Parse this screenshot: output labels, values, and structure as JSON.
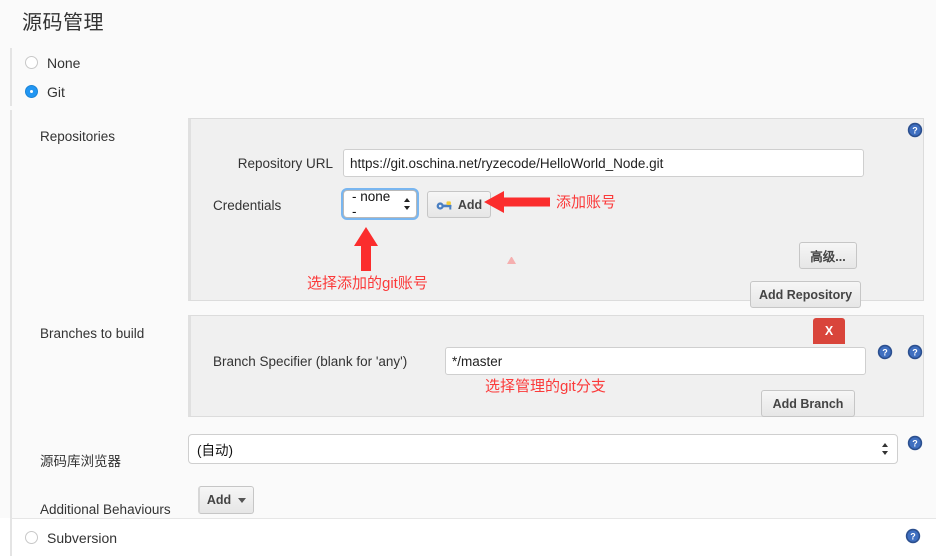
{
  "page": {
    "title": "源码管理"
  },
  "scm_options": [
    {
      "label": "None",
      "selected": false
    },
    {
      "label": "Git",
      "selected": true
    },
    {
      "label": "Subversion",
      "selected": false
    }
  ],
  "git": {
    "repositories": {
      "section_label": "Repositories",
      "repository_url": {
        "label": "Repository URL",
        "value": "https://git.oschina.net/ryzecode/HelloWorld_Node.git"
      },
      "credentials": {
        "label": "Credentials",
        "selected": "- none -",
        "options": [
          "- none -"
        ],
        "add_button": "Add",
        "add_button_icon": "key-icon"
      },
      "advanced_button": "高级...",
      "add_repository_button": "Add Repository"
    },
    "branches": {
      "section_label": "Branches to build",
      "branch_specifier": {
        "label": "Branch Specifier (blank for 'any')",
        "value": "*/master"
      },
      "delete_button": "X",
      "add_branch_button": "Add Branch"
    },
    "browser": {
      "label": "源码库浏览器",
      "selected": "(自动)",
      "options": [
        "(自动)"
      ]
    },
    "additional_behaviours": {
      "label": "Additional Behaviours",
      "add_button": "Add"
    }
  },
  "annotations": [
    {
      "text": "添加账号",
      "id": "annotation-add-account"
    },
    {
      "text": "选择添加的git账号",
      "id": "annotation-select-git-account"
    },
    {
      "text": "选择管理的git分支",
      "id": "annotation-select-git-branch"
    }
  ],
  "icons": {
    "help": "help-icon"
  },
  "colors": {
    "accent": "#2196f3",
    "annotation_red": "#fb3a3a",
    "delete_red": "#d9453b",
    "panel_grey": "#f0f0f0",
    "page_bg": "#fafafa"
  }
}
